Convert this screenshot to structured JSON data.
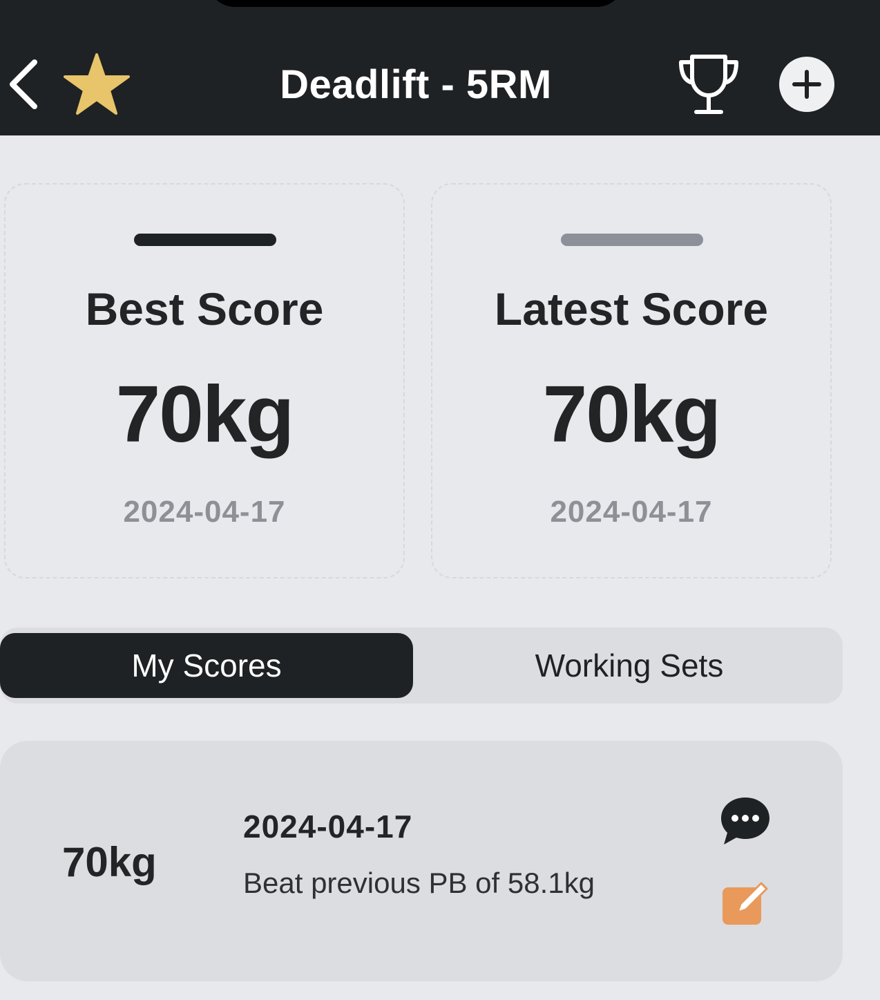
{
  "header": {
    "title": "Deadlift - 5RM"
  },
  "icons": {
    "back": "chevron-left-icon",
    "favorite": "star-icon",
    "records": "trophy-icon",
    "add": "plus-circle-icon",
    "comment": "chat-bubble-icon",
    "edit": "edit-icon"
  },
  "colors": {
    "header_bg": "#1f2224",
    "star": "#e8c46a",
    "edit": "#e9995a",
    "best_bar": "#1f2224",
    "latest_bar": "#8b9099"
  },
  "cards": {
    "best": {
      "label": "Best Score",
      "value": "70kg",
      "date": "2024-04-17"
    },
    "latest": {
      "label": "Latest Score",
      "value": "70kg",
      "date": "2024-04-17"
    }
  },
  "tabs": {
    "active": "My Scores",
    "items": [
      {
        "label": "My Scores"
      },
      {
        "label": "Working Sets"
      }
    ]
  },
  "scores": [
    {
      "value": "70kg",
      "date": "2024-04-17",
      "note": "Beat previous PB of 58.1kg"
    }
  ]
}
